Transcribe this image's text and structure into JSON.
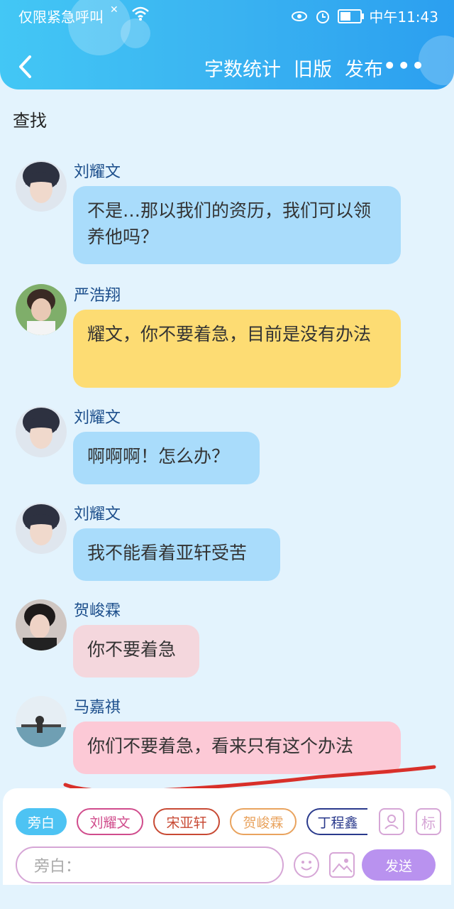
{
  "status_bar": {
    "carrier": "仅限紧急呼叫",
    "time": "中午11:43",
    "battery_level": 0.55
  },
  "nav": {
    "word_count": "字数统计",
    "old_version": "旧版",
    "publish": "发布",
    "more": "•••"
  },
  "search_label": "查找",
  "messages": [
    {
      "sender": "刘耀文",
      "text": "不是…那以我们的资历，我们可以领养他吗？"
    },
    {
      "sender": "严浩翔",
      "text": "耀文，你不要着急，目前是没有办法"
    },
    {
      "sender": "刘耀文",
      "text": "啊啊啊！怎么办？"
    },
    {
      "sender": "刘耀文",
      "text": "我不能看着亚轩受苦"
    },
    {
      "sender": "贺峻霖",
      "text": "你不要着急"
    },
    {
      "sender": "马嘉祺",
      "text": "你们不要着急，看来只有这个办法"
    }
  ],
  "role_chips": [
    "旁白",
    "刘耀文",
    "宋亚轩",
    "贺峻霖",
    "丁程鑫"
  ],
  "tools": {
    "role_icon": "person-icon",
    "tag_label": "标"
  },
  "input": {
    "placeholder": "旁白："
  },
  "send_label": "发送",
  "colors": {
    "header": "#3ab3f1",
    "blue_bubble": "#a9dcfb",
    "yellow_bubble": "#fddc73",
    "pink_bubble": "#fcc9d6",
    "underline": "#d8302a",
    "send": "#b992ef"
  }
}
